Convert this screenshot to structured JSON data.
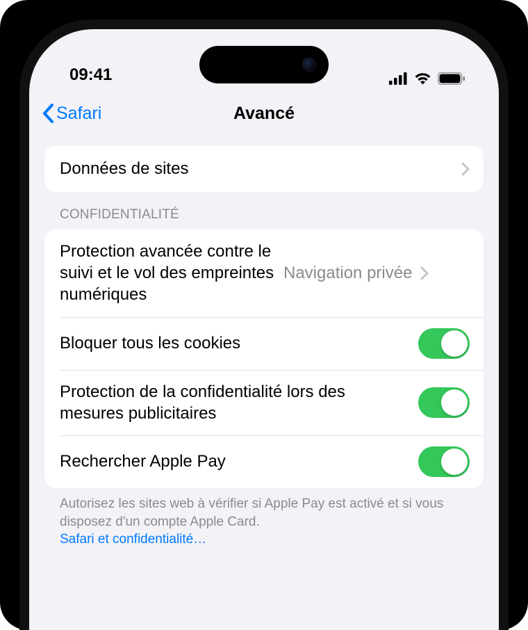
{
  "statusBar": {
    "time": "09:41"
  },
  "nav": {
    "back": "Safari",
    "title": "Avancé"
  },
  "group1": {
    "siteData": "Données de sites"
  },
  "privacy": {
    "header": "Confidentialité",
    "tracking": {
      "label": "Protection avancée contre le suivi et le vol des empreintes numériques",
      "value": "Navigation privée"
    },
    "blockCookies": "Bloquer tous les cookies",
    "adMeasurement": "Protection de la confidentialité lors des mesures publicitaires",
    "applePay": "Rechercher Apple Pay",
    "footer": "Autorisez les sites web à vérifier si Apple Pay est activé et si vous disposez d'un compte Apple Card.",
    "footerLink": "Safari et confidentialité…"
  }
}
